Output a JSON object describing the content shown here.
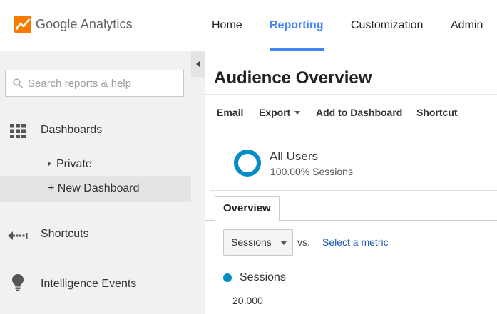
{
  "header": {
    "app_name": "Google Analytics",
    "nav": [
      {
        "label": "Home",
        "active": false
      },
      {
        "label": "Reporting",
        "active": true
      },
      {
        "label": "Customization",
        "active": false
      },
      {
        "label": "Admin",
        "active": false
      }
    ],
    "accent_color": "#4285f4"
  },
  "sidebar": {
    "search_placeholder": "Search reports & help",
    "dashboards": {
      "label": "Dashboards",
      "icon": "grid-icon",
      "children": [
        {
          "label": "Private"
        },
        {
          "label": "+ New Dashboard"
        }
      ]
    },
    "shortcuts": {
      "label": "Shortcuts",
      "icon": "shortcut-arrow-icon"
    },
    "intelligence": {
      "label": "Intelligence Events",
      "icon": "lightbulb-icon"
    }
  },
  "main": {
    "title": "Audience Overview",
    "toolbar": {
      "email": "Email",
      "export": "Export",
      "add_to_dashboard": "Add to Dashboard",
      "shortcut": "Shortcut"
    },
    "segment": {
      "name": "All Users",
      "detail": "100.00% Sessions",
      "color": "#058dc7"
    },
    "tab": "Overview",
    "metric": {
      "selected": "Sessions",
      "vs": "vs.",
      "select_link": "Select a metric"
    },
    "legend": {
      "label": "Sessions",
      "color": "#058dc7"
    },
    "axis": {
      "top_value": "20,000"
    }
  }
}
